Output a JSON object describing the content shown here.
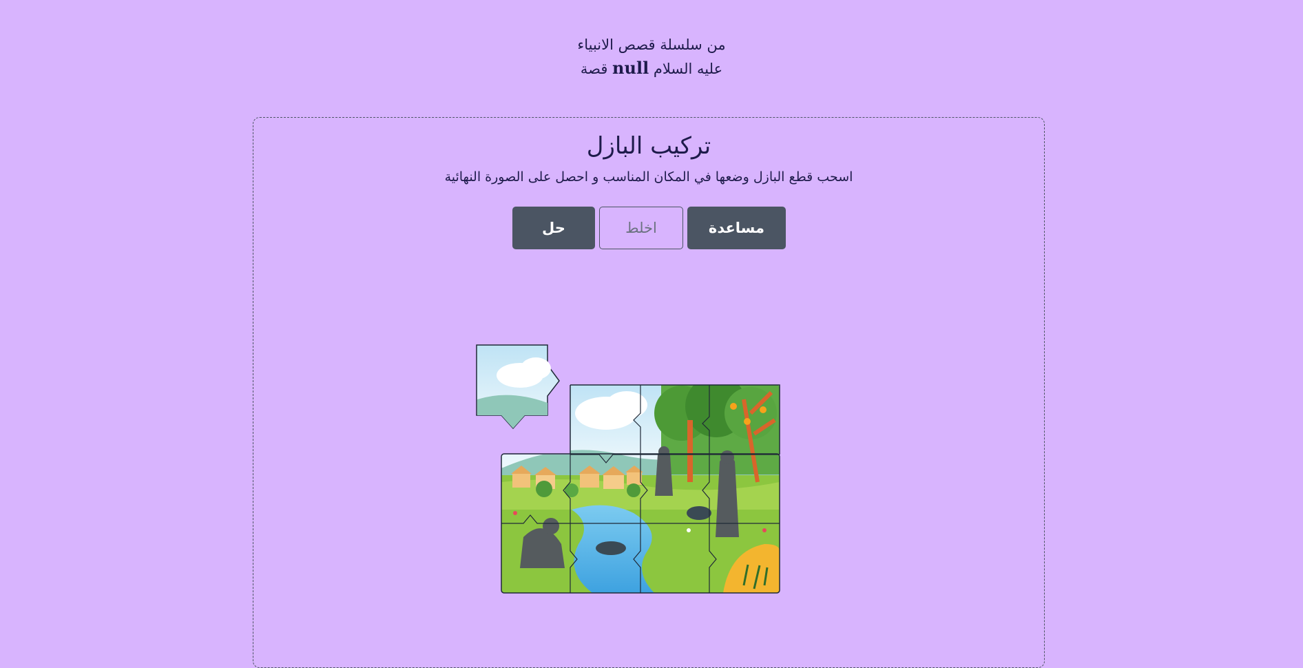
{
  "header": {
    "series_line": "من سلسلة قصص الانبياء",
    "story_prefix": "قصة",
    "story_name": "null",
    "story_suffix": "عليه السلام"
  },
  "puzzle": {
    "title": "تركيب البازل",
    "instructions": "اسحب قطع البازل وضعها في المكان المناسب و احصل على الصورة النهائية",
    "buttons": {
      "help": "مساعدة",
      "shuffle": "اخلط",
      "solve": "حل"
    }
  },
  "colors": {
    "background": "#d8b4fe",
    "button_dark": "#4b5563",
    "sky": "#e6f4fb",
    "grass": "#86c23a",
    "river": "#4fb3e8",
    "tree_trunk": "#d9652b"
  }
}
